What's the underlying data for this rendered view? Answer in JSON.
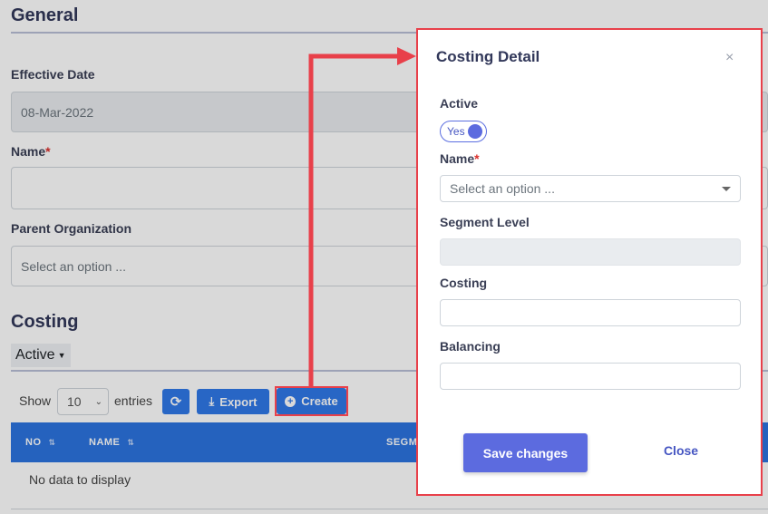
{
  "general": {
    "title": "General",
    "effective_date_label": "Effective Date",
    "effective_date_value": "08-Mar-2022",
    "name_label": "Name",
    "required_mark": "*",
    "parent_org_label": "Parent Organization",
    "parent_org_placeholder": "Select an option ..."
  },
  "costing": {
    "title": "Costing",
    "status_filter": "Active",
    "show_label": "Show",
    "page_size": "10",
    "entries_label": "entries",
    "export_label": "Export",
    "create_label": "Create",
    "columns": [
      "NO",
      "NAME",
      "SEGM"
    ],
    "empty_text": "No data to display"
  },
  "modal": {
    "title": "Costing Detail",
    "close_icon": "×",
    "active_label": "Active",
    "active_toggle_text": "Yes",
    "active_value": true,
    "name_label": "Name",
    "required_mark": "*",
    "name_placeholder": "Select an option ...",
    "segment_level_label": "Segment Level",
    "costing_label": "Costing",
    "balancing_label": "Balancing",
    "save_label": "Save changes",
    "close_label": "Close"
  },
  "colors": {
    "accent": "#5c6bdf",
    "table_header": "#2c74e0",
    "annotation": "#e8404a"
  }
}
